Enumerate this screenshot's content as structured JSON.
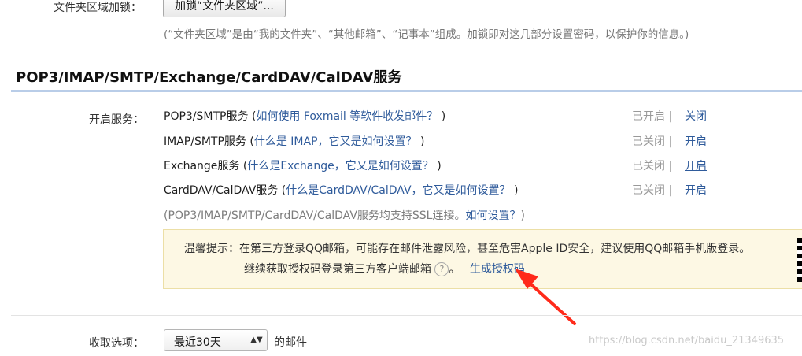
{
  "folder_lock": {
    "label": "文件夹区域加锁：",
    "button": "加锁“文件夹区域”...",
    "hint": "(“文件夹区域”是由“我的文件夹”、“其他邮箱”、“记事本”组成。加锁即对这几部分设置密码，以保护你的信息。)"
  },
  "section": {
    "title": "POP3/IMAP/SMTP/Exchange/CardDAV/CalDAV服务"
  },
  "services": {
    "label": "开启服务：",
    "items": [
      {
        "name": "POP3/SMTP服务 (",
        "link": "如何使用 Foxmail 等软件收发邮件？",
        "close": ")",
        "status": "已开启",
        "sep": "|",
        "action": "关闭"
      },
      {
        "name": "IMAP/SMTP服务 (",
        "link": "什么是 IMAP，它又是如何设置？",
        "close": ")",
        "status": "已关闭",
        "sep": "|",
        "action": "开启"
      },
      {
        "name": "Exchange服务 (",
        "link": "什么是Exchange，它又是如何设置？",
        "close": ")",
        "status": "已关闭",
        "sep": "|",
        "action": "开启"
      },
      {
        "name": "CardDAV/CalDAV服务 (",
        "link": "什么是CardDAV/CalDAV，它又是如何设置？",
        "close": ")",
        "status": "已关闭",
        "sep": "|",
        "action": "开启"
      }
    ],
    "ssl_note": "(POP3/IMAP/SMTP/CardDAV/CalDAV服务均支持SSL连接。",
    "ssl_link": "如何设置？",
    "ssl_close": ")"
  },
  "tip": {
    "line1": "温馨提示：在第三方登录QQ邮箱，可能存在邮件泄露风险，甚至危害Apple ID安全，建议使用QQ邮箱手机版登录。",
    "line2": "继续获取授权码登录第三方客户端邮箱",
    "help_glyph": "?",
    "period": "。",
    "link": "生成授权码"
  },
  "receive": {
    "label": "收取选项：",
    "selected": "最近30天",
    "suffix": "的邮件"
  },
  "watermark": "https://blog.csdn.net/baidu_21349635",
  "colors": {
    "link": "#2f5b9b",
    "arrow": "#ff2a1a",
    "tip_bg": "#fdf8e4",
    "section_line": "#b9cde8"
  }
}
